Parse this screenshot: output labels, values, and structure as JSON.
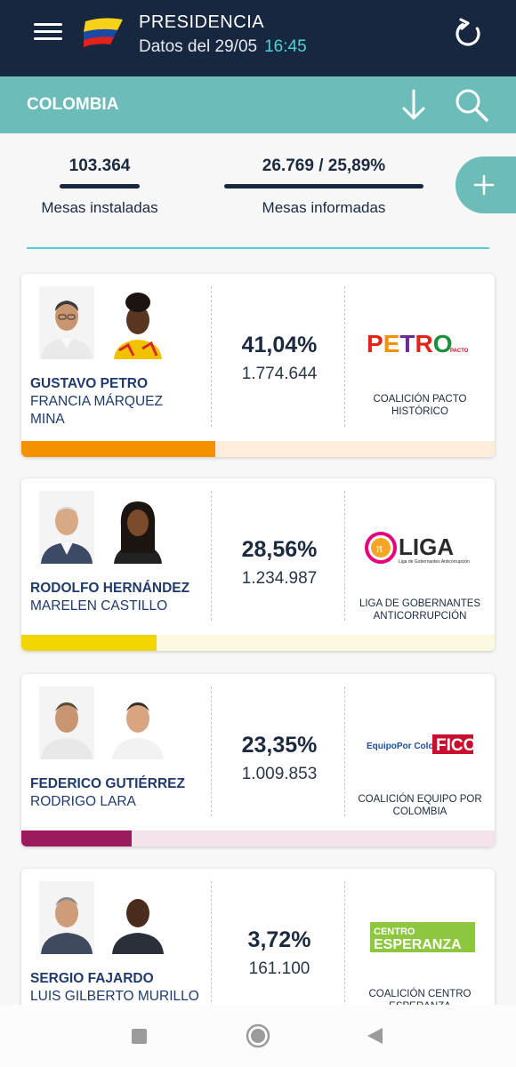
{
  "header": {
    "title": "PRESIDENCIA",
    "date_text": "Datos del 29/05",
    "time": "16:45"
  },
  "region": {
    "name": "COLOMBIA"
  },
  "stats": {
    "installed_value": "103.364",
    "installed_label": "Mesas instaladas",
    "reported_value": "26.769 / 25,89%",
    "reported_label": "Mesas informadas"
  },
  "candidates": [
    {
      "name": "GUSTAVO PETRO",
      "running_mate_line1": "FRANCIA MÁRQUEZ",
      "running_mate_line2": "MINA",
      "percent": "41,04%",
      "votes": "1.774.644",
      "party_line1": "COALICIÓN PACTO",
      "party_line2": "HISTÓRICO",
      "logo_text": "PETRO",
      "logo_small": "PACTO",
      "share": 0.4104,
      "bar_color": "#f29200",
      "bar_bg": "#fdeedb"
    },
    {
      "name": "RODOLFO HERNÁNDEZ",
      "running_mate_line1": "MARELEN CASTILLO",
      "running_mate_line2": "",
      "percent": "28,56%",
      "votes": "1.234.987",
      "party_line1": "LIGA DE GOBERNANTES",
      "party_line2": "ANTICORRUPCIÓN",
      "logo_text": "LIGA",
      "logo_small": "Liga de Gobernantes Anticorrupción",
      "share": 0.2856,
      "bar_color": "#f2d600",
      "bar_bg": "#fdf8e0"
    },
    {
      "name": "FEDERICO GUTIÉRREZ",
      "running_mate_line1": "RODRIGO LARA",
      "running_mate_line2": "",
      "percent": "23,35%",
      "votes": "1.009.853",
      "party_line1": "COALICIÓN EQUIPO POR",
      "party_line2": "COLOMBIA",
      "logo_text": "FICO",
      "logo_small": "EquipoPor Colombia",
      "share": 0.2335,
      "bar_color": "#9b1b5e",
      "bar_bg": "#f5e3ec"
    },
    {
      "name": "SERGIO FAJARDO",
      "running_mate_line1": "LUIS GILBERTO MURILLO",
      "running_mate_line2": "",
      "percent": "3,72%",
      "votes": "161.100",
      "party_line1": "COALICIÓN CENTRO",
      "party_line2": "ESPERANZA",
      "logo_text": "ESPERANZA",
      "logo_small": "CENTRO",
      "share": 0.0372,
      "bar_color": "#8dc63f",
      "bar_bg": "#eef6e3"
    }
  ],
  "icons": {
    "menu": "menu-icon",
    "flag": "colombia-flag-icon",
    "refresh": "refresh-icon",
    "download": "download-icon",
    "search": "search-icon",
    "plus": "plus-icon"
  },
  "colors": {
    "header_bg": "#17273f",
    "region_bg": "#6cbcb9",
    "accent": "#4fd2d6"
  }
}
